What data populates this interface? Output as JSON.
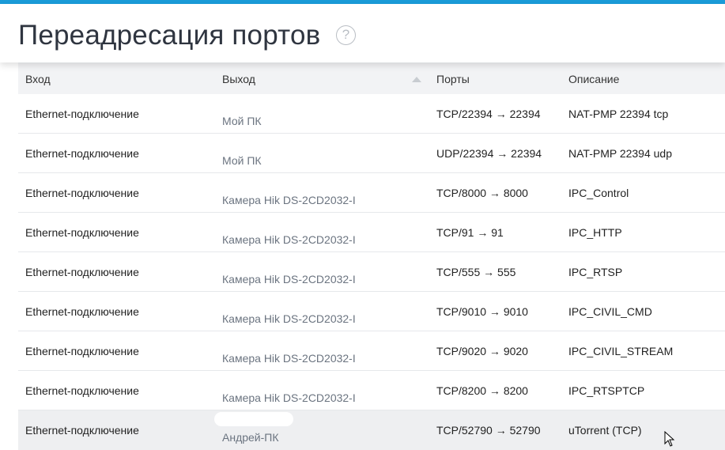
{
  "page": {
    "title": "Переадресация портов",
    "help_icon_glyph": "?"
  },
  "table": {
    "headers": [
      "Вход",
      "Выход",
      "Порты",
      "Описание"
    ],
    "sort_column": "Выход",
    "sort_direction": "ascending",
    "rows": [
      {
        "input": "Ethernet-подключение",
        "output": "Мой ПК",
        "ports": "TCP/22394 → 22394",
        "description": "NAT-PMP 22394 tcp"
      },
      {
        "input": "Ethernet-подключение",
        "output": "Мой ПК",
        "ports": "UDP/22394 → 22394",
        "description": "NAT-PMP 22394 udp"
      },
      {
        "input": "Ethernet-подключение",
        "output": "Камера Hik DS-2CD2032-I",
        "ports": "TCP/8000 → 8000",
        "description": "IPC_Control"
      },
      {
        "input": "Ethernet-подключение",
        "output": "Камера Hik DS-2CD2032-I",
        "ports": "TCP/91 → 91",
        "description": "IPC_HTTP"
      },
      {
        "input": "Ethernet-подключение",
        "output": "Камера Hik DS-2CD2032-I",
        "ports": "TCP/555 → 555",
        "description": "IPC_RTSP"
      },
      {
        "input": "Ethernet-подключение",
        "output": "Камера Hik DS-2CD2032-I",
        "ports": "TCP/9010 → 9010",
        "description": "IPC_CIVIL_CMD"
      },
      {
        "input": "Ethernet-подключение",
        "output": "Камера Hik DS-2CD2032-I",
        "ports": "TCP/9020 → 9020",
        "description": "IPC_CIVIL_STREAM"
      },
      {
        "input": "Ethernet-подключение",
        "output": "Камера Hik DS-2CD2032-I",
        "ports": "TCP/8200 → 8200",
        "description": "IPC_RTSPTCP"
      },
      {
        "input": "Ethernet-подключение",
        "output": "Андрей-ПК",
        "ports": "TCP/52790 → 52790",
        "description": "uTorrent (TCP)"
      }
    ]
  },
  "colors": {
    "accent": "#1a9bd8",
    "header_bg": "#f2f3f5",
    "hover_row_bg": "#eeeff1",
    "muted_text": "#6b7480"
  }
}
